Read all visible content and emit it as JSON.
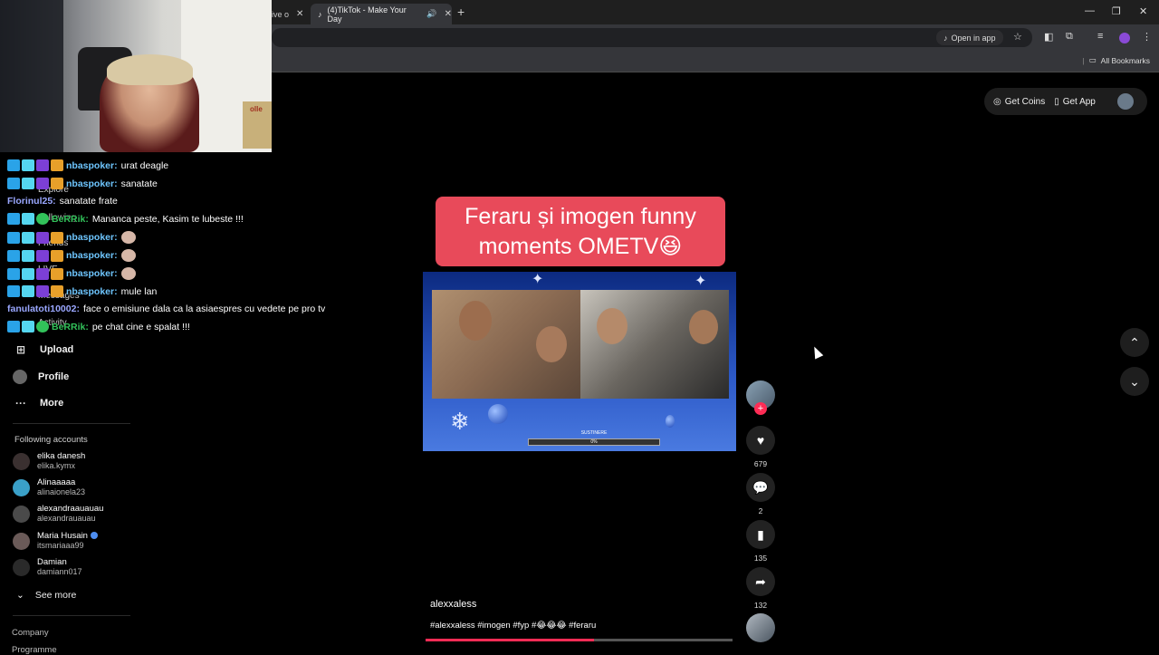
{
  "browser": {
    "tab_partial_label": "ive o",
    "active_tab_title": "(4)TikTok - Make Your Day",
    "new_tab": "+",
    "open_in_app": "Open in app",
    "all_bookmarks": "All Bookmarks"
  },
  "webcam": {
    "box_label": "olle"
  },
  "sidebar": {
    "nav": [
      {
        "label": "Explore"
      },
      {
        "label": "Following"
      },
      {
        "label": "Friends"
      },
      {
        "label": "LIVE"
      },
      {
        "label": "Messages"
      },
      {
        "label": "Activity"
      },
      {
        "label": "Upload"
      },
      {
        "label": "Profile"
      },
      {
        "label": "More"
      }
    ],
    "following_heading": "Following accounts",
    "accounts": [
      {
        "name": "elika danesh",
        "handle": "elika.kymx"
      },
      {
        "name": "Alinaaaaa",
        "handle": "alinaionela23"
      },
      {
        "name": "alexandraauauau",
        "handle": "alexandrauauau"
      },
      {
        "name": "Maria Husain",
        "handle": "itsmariaaa99"
      },
      {
        "name": "Damian",
        "handle": "damiann017"
      }
    ],
    "see_more": "See more",
    "company": "Company",
    "programme": "Programme"
  },
  "chat": [
    {
      "user": "nbaspoker:",
      "color": "#6ec6ff",
      "text": "urat deagle"
    },
    {
      "user": "nbaspoker:",
      "color": "#6ec6ff",
      "text": "sanatate"
    },
    {
      "user": "Florinul25:",
      "color": "#9aa7ff",
      "text": "sanatate frate"
    },
    {
      "user": "BeRRik:",
      "color": "#32c25a",
      "text": "Mananca peste, Kasim te lubeste !!!"
    },
    {
      "user": "nbaspoker:",
      "color": "#6ec6ff",
      "text": ""
    },
    {
      "user": "nbaspoker:",
      "color": "#6ec6ff",
      "text": ""
    },
    {
      "user": "nbaspoker:",
      "color": "#6ec6ff",
      "text": ""
    },
    {
      "user": "nbaspoker:",
      "color": "#6ec6ff",
      "text": "mule lan"
    },
    {
      "user": "fanulatoti10002:",
      "color": "#9aa7ff",
      "text": "face o emisiune dala ca la asiaespres cu vedete pe pro tv"
    },
    {
      "user": "BeRRik:",
      "color": "#32c25a",
      "text": "pe chat cine e spalat !!!"
    }
  ],
  "header": {
    "get_coins": "Get Coins",
    "get_app": "Get App"
  },
  "video": {
    "banner_line1": "Feraru și imogen funny",
    "banner_line2": "moments OMETV😆",
    "overlay_label": "SUSTINERE",
    "overlay_percent": "0%",
    "author": "alexxaless",
    "caption": "#alexxaless #imogen #fyp #😂😂😂 #feraru",
    "progress": 0.55
  },
  "actions": {
    "likes": "679",
    "comments": "2",
    "saves": "135",
    "shares": "132"
  },
  "colors": {
    "accent": "#fe2c55",
    "banner": "#e84a5a"
  }
}
